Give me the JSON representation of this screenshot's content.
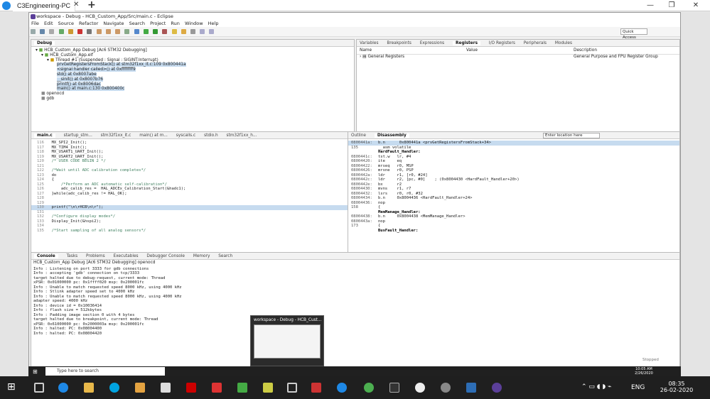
{
  "remote": {
    "tab_title": "C3Engineering-PC",
    "close": "✕",
    "add": "+",
    "min": "—",
    "restore": "❐",
    "close_win": "✕"
  },
  "eclipse": {
    "title": "workspace - Debug - HCB_Custom_App/Src/main.c - Eclipse",
    "menu": [
      "File",
      "Edit",
      "Source",
      "Refactor",
      "Navigate",
      "Search",
      "Project",
      "Run",
      "Window",
      "Help"
    ],
    "quick_access": "Quick Access"
  },
  "debug_view": {
    "tab": "Debug",
    "tree": [
      "HCB_Custom_App Debug [Ac6 STM32 Debugging]",
      "HCB_Custom_App.elf",
      "Thread #1 (Suspended : Signal : SIGINT:Interrupt)",
      "prvGetRegistersFromStack() at stm32f1xx_it.c:109 0x800441a",
      "<signal handler called>() at 0xffffffff9",
      "std() at 0x8007abe",
      "__sinit() at 0x8007b76",
      "printf() at 0x8006dac",
      "main() at main.c:130 0x800400c",
      "openocd",
      "gdb"
    ]
  },
  "registers_view": {
    "tabs": [
      "Variables",
      "Breakpoints",
      "Expressions",
      "Registers",
      "I/O Registers",
      "Peripherals",
      "Modules"
    ],
    "columns": [
      "Name",
      "Value",
      "Description"
    ],
    "rows": [
      {
        "name": "General Registers",
        "value": "",
        "description": "General Purpose and FPU Register Group"
      }
    ]
  },
  "editor": {
    "tabs": [
      "main.c",
      "startup_stm...",
      "stm32f1xx_it.c",
      "main() at m...",
      "syscalls.c",
      "stdio.h",
      "stm32f1xx_h..."
    ],
    "lines": [
      {
        "n": "116",
        "t": "  MX_SPI2_Init();"
      },
      {
        "n": "117",
        "t": "  MX_TIM4_Init();"
      },
      {
        "n": "118",
        "t": "  MX_USART1_UART_Init();"
      },
      {
        "n": "119",
        "t": "  MX_USART2_UART_Init();"
      },
      {
        "n": "120",
        "t": "  /* USER CODE BEGIN 2 */"
      },
      {
        "n": "121",
        "t": ""
      },
      {
        "n": "122",
        "t": "  /*Wait until ADC calibration completes*/"
      },
      {
        "n": "123",
        "t": "  do"
      },
      {
        "n": "124",
        "t": "  {"
      },
      {
        "n": "125",
        "t": "      /*Perform an ADC automatic self-calibration*/"
      },
      {
        "n": "126",
        "t": "      adc_calib_res =  HAL_ADCEx_Calibration_Start(&hadc1);"
      },
      {
        "n": "127",
        "t": "  }while(adc_calib_res != HAL_OK);"
      },
      {
        "n": "128",
        "t": ""
      },
      {
        "n": "129",
        "t": ""
      },
      {
        "n": "130",
        "t": "  printf(\"\\n\\rHCB\\n\\r\");"
      },
      {
        "n": "131",
        "t": ""
      },
      {
        "n": "132",
        "t": "  /*Configure display modes*/"
      },
      {
        "n": "133",
        "t": "  Display_Init(&hspi2);"
      },
      {
        "n": "134",
        "t": ""
      },
      {
        "n": "135",
        "t": "  /*Start sampling of all analog sensors*/"
      }
    ]
  },
  "disassembly": {
    "tabs": [
      "Outline",
      "Disassembly"
    ],
    "location_placeholder": "Enter location here",
    "lines": [
      {
        "a": "0800441a:",
        "i": "b.n      0x800441a <prvGetRegistersFromStack+34>"
      },
      {
        "a": "135",
        "i": "__asm volatile"
      },
      {
        "a": "",
        "i": "HardFault_Handler:"
      },
      {
        "a": "0800441c:",
        "i": "tst.w   lr, #4"
      },
      {
        "a": "08004420:",
        "i": "ite     eq"
      },
      {
        "a": "08004422:",
        "i": "mrseq   r0, MSP"
      },
      {
        "a": "08004426:",
        "i": "mrsne   r0, PSP"
      },
      {
        "a": "0800442a:",
        "i": "ldr     r1, [r0, #24]"
      },
      {
        "a": "0800442c:",
        "i": "ldr     r2, [pc, #0]    ; (0x8004430 <HardFault_Handler+20>)"
      },
      {
        "a": "0800442e:",
        "i": "bx      r2"
      },
      {
        "a": "08004430:",
        "i": "mvns    r1, r7"
      },
      {
        "a": "08004432:",
        "i": "lsrs    r0, r0, #32"
      },
      {
        "a": "08004434:",
        "i": "b.n     0x8004436 <HardFault_Handler+24>"
      },
      {
        "a": "08004436:",
        "i": "nop"
      },
      {
        "a": "158",
        "i": "{"
      },
      {
        "a": "",
        "i": "MemManage_Handler:"
      },
      {
        "a": "08004438:",
        "i": "b.n     0x8004438 <MemManage_Handler>"
      },
      {
        "a": "0800443a:",
        "i": "nop"
      },
      {
        "a": "173",
        "i": "{"
      },
      {
        "a": "",
        "i": "BusFault_Handler:"
      }
    ]
  },
  "console": {
    "tabs": [
      "Console",
      "Tasks",
      "Problems",
      "Executables",
      "Debugger Console",
      "Memory",
      "Search"
    ],
    "header": "HCB_Custom_App Debug [Ac6 STM32 Debugging] openocd",
    "lines": [
      "Info : Listening on port 3333 for gdb connections",
      "Info : accepting 'gdb' connection on tcp/3333",
      "target halted due to debug-request, current mode: Thread",
      "xPSR: 0x01000000 pc: 0x1ffff020 msp: 0x200001fc",
      "Info : Unable to match requested speed 8000 kHz, using 4000 kHz",
      "Info : Stlink adapter speed set to 4000 kHz",
      "Info : Unable to match requested speed 8000 kHz, using 4000 kHz",
      "adapter speed: 4000 kHz",
      "Info : device id = 0x10036414",
      "Info : flash size = 512kbytes",
      "Info : Padding image section 0 with 4 bytes",
      "target halted due to breakpoint, current mode: Thread",
      "xPSR: 0x61000000 pc: 0x2000003a msp: 0x200001fc",
      "Info : halted: PC: 0x08004400",
      "Info : halted: PC: 0x08004420"
    ],
    "status": "Stopped"
  },
  "thumbnail": {
    "title": "workspace - Debug - HCB_Cust..."
  },
  "inner_taskbar": {
    "search": "Type here to search",
    "time": "10:05 AM",
    "date": "2/26/2020"
  },
  "taskbar": {
    "lang": "ENG",
    "time": "08:35",
    "date": "26-02-2020"
  },
  "colors": {
    "accent": "#1e88e5",
    "eclipse": "#5b3f99",
    "highlight": "#c6dbef"
  }
}
